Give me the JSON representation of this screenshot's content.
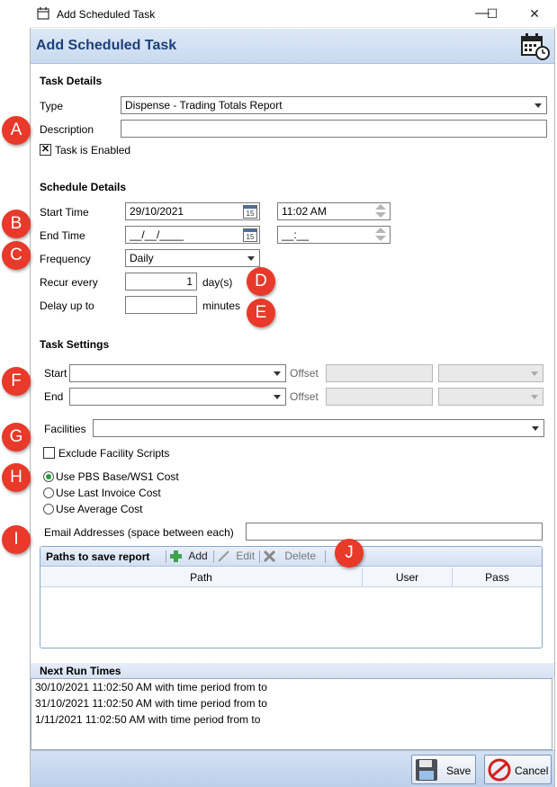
{
  "window": {
    "title": "Add Scheduled Task",
    "minimize": "—",
    "maximize": "☐",
    "close": "✕"
  },
  "header": {
    "title": "Add Scheduled Task"
  },
  "task_details": {
    "heading": "Task Details",
    "type_label": "Type",
    "type_value": "Dispense - Trading Totals Report",
    "description_label": "Description",
    "description_value": "",
    "enabled_label": "Task is Enabled",
    "enabled_checked": true
  },
  "schedule_details": {
    "heading": "Schedule Details",
    "start_time_label": "Start Time",
    "start_date": "29/10/2021",
    "start_time": "11:02  AM",
    "end_time_label": "End Time",
    "end_date": "__/__/____",
    "end_time": "__:__",
    "calendar_day": "15",
    "frequency_label": "Frequency",
    "frequency_value": "Daily",
    "recur_label": "Recur every",
    "recur_value": "1",
    "recur_unit": "day(s)",
    "delay_label": "Delay up to",
    "delay_value": "",
    "delay_unit": "minutes"
  },
  "task_settings": {
    "heading": "Task Settings",
    "start_label": "Start",
    "end_label": "End",
    "offset_label": "Offset",
    "facilities_label": "Facilities",
    "exclude_label": "Exclude Facility Scripts",
    "exclude_checked": false,
    "cost_options": [
      "Use PBS Base/WS1 Cost",
      "Use Last Invoice Cost",
      "Use Average Cost"
    ],
    "cost_selected": "Use PBS Base/WS1 Cost",
    "email_label": "Email Addresses (space between each)",
    "email_value": ""
  },
  "paths": {
    "title": "Paths to save report",
    "add": "Add",
    "edit": "Edit",
    "delete": "Delete",
    "columns": [
      "Path",
      "User",
      "Pass"
    ]
  },
  "next_run": {
    "heading": "Next Run Times",
    "lines": [
      "30/10/2021 11:02:50 AM with time period from  to",
      "31/10/2021 11:02:50 AM with time period from  to",
      "1/11/2021 11:02:50 AM with time period from  to"
    ]
  },
  "footer": {
    "save": "Save",
    "cancel": "Cancel"
  },
  "markers": [
    "A",
    "B",
    "C",
    "D",
    "E",
    "F",
    "G",
    "H",
    "I",
    "J"
  ],
  "colors": {
    "header_title": "#1e3f7a",
    "marker": "#e8392a",
    "radio_selected": "#2a9a3a",
    "header_bg": "#c9daf0"
  },
  "icons": [
    "calendar-clock-icon",
    "calendar-icon",
    "spin-icon",
    "chevron-down-icon",
    "add-icon",
    "edit-icon",
    "delete-icon",
    "save-icon",
    "cancel-icon"
  ]
}
